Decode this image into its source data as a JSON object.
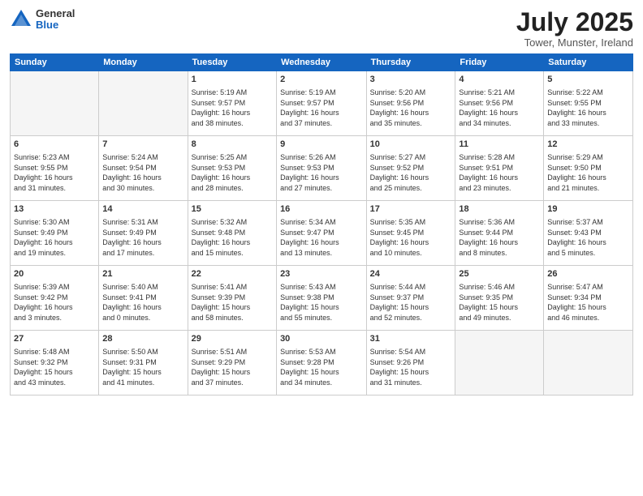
{
  "header": {
    "logo_general": "General",
    "logo_blue": "Blue",
    "month_title": "July 2025",
    "location": "Tower, Munster, Ireland"
  },
  "weekdays": [
    "Sunday",
    "Monday",
    "Tuesday",
    "Wednesday",
    "Thursday",
    "Friday",
    "Saturday"
  ],
  "weeks": [
    [
      {
        "day": "",
        "empty": true
      },
      {
        "day": "",
        "empty": true
      },
      {
        "day": "1",
        "info": "Sunrise: 5:19 AM\nSunset: 9:57 PM\nDaylight: 16 hours\nand 38 minutes."
      },
      {
        "day": "2",
        "info": "Sunrise: 5:19 AM\nSunset: 9:57 PM\nDaylight: 16 hours\nand 37 minutes."
      },
      {
        "day": "3",
        "info": "Sunrise: 5:20 AM\nSunset: 9:56 PM\nDaylight: 16 hours\nand 35 minutes."
      },
      {
        "day": "4",
        "info": "Sunrise: 5:21 AM\nSunset: 9:56 PM\nDaylight: 16 hours\nand 34 minutes."
      },
      {
        "day": "5",
        "info": "Sunrise: 5:22 AM\nSunset: 9:55 PM\nDaylight: 16 hours\nand 33 minutes."
      }
    ],
    [
      {
        "day": "6",
        "info": "Sunrise: 5:23 AM\nSunset: 9:55 PM\nDaylight: 16 hours\nand 31 minutes."
      },
      {
        "day": "7",
        "info": "Sunrise: 5:24 AM\nSunset: 9:54 PM\nDaylight: 16 hours\nand 30 minutes."
      },
      {
        "day": "8",
        "info": "Sunrise: 5:25 AM\nSunset: 9:53 PM\nDaylight: 16 hours\nand 28 minutes."
      },
      {
        "day": "9",
        "info": "Sunrise: 5:26 AM\nSunset: 9:53 PM\nDaylight: 16 hours\nand 27 minutes."
      },
      {
        "day": "10",
        "info": "Sunrise: 5:27 AM\nSunset: 9:52 PM\nDaylight: 16 hours\nand 25 minutes."
      },
      {
        "day": "11",
        "info": "Sunrise: 5:28 AM\nSunset: 9:51 PM\nDaylight: 16 hours\nand 23 minutes."
      },
      {
        "day": "12",
        "info": "Sunrise: 5:29 AM\nSunset: 9:50 PM\nDaylight: 16 hours\nand 21 minutes."
      }
    ],
    [
      {
        "day": "13",
        "info": "Sunrise: 5:30 AM\nSunset: 9:49 PM\nDaylight: 16 hours\nand 19 minutes."
      },
      {
        "day": "14",
        "info": "Sunrise: 5:31 AM\nSunset: 9:49 PM\nDaylight: 16 hours\nand 17 minutes."
      },
      {
        "day": "15",
        "info": "Sunrise: 5:32 AM\nSunset: 9:48 PM\nDaylight: 16 hours\nand 15 minutes."
      },
      {
        "day": "16",
        "info": "Sunrise: 5:34 AM\nSunset: 9:47 PM\nDaylight: 16 hours\nand 13 minutes."
      },
      {
        "day": "17",
        "info": "Sunrise: 5:35 AM\nSunset: 9:45 PM\nDaylight: 16 hours\nand 10 minutes."
      },
      {
        "day": "18",
        "info": "Sunrise: 5:36 AM\nSunset: 9:44 PM\nDaylight: 16 hours\nand 8 minutes."
      },
      {
        "day": "19",
        "info": "Sunrise: 5:37 AM\nSunset: 9:43 PM\nDaylight: 16 hours\nand 5 minutes."
      }
    ],
    [
      {
        "day": "20",
        "info": "Sunrise: 5:39 AM\nSunset: 9:42 PM\nDaylight: 16 hours\nand 3 minutes."
      },
      {
        "day": "21",
        "info": "Sunrise: 5:40 AM\nSunset: 9:41 PM\nDaylight: 16 hours\nand 0 minutes."
      },
      {
        "day": "22",
        "info": "Sunrise: 5:41 AM\nSunset: 9:39 PM\nDaylight: 15 hours\nand 58 minutes."
      },
      {
        "day": "23",
        "info": "Sunrise: 5:43 AM\nSunset: 9:38 PM\nDaylight: 15 hours\nand 55 minutes."
      },
      {
        "day": "24",
        "info": "Sunrise: 5:44 AM\nSunset: 9:37 PM\nDaylight: 15 hours\nand 52 minutes."
      },
      {
        "day": "25",
        "info": "Sunrise: 5:46 AM\nSunset: 9:35 PM\nDaylight: 15 hours\nand 49 minutes."
      },
      {
        "day": "26",
        "info": "Sunrise: 5:47 AM\nSunset: 9:34 PM\nDaylight: 15 hours\nand 46 minutes."
      }
    ],
    [
      {
        "day": "27",
        "info": "Sunrise: 5:48 AM\nSunset: 9:32 PM\nDaylight: 15 hours\nand 43 minutes."
      },
      {
        "day": "28",
        "info": "Sunrise: 5:50 AM\nSunset: 9:31 PM\nDaylight: 15 hours\nand 41 minutes."
      },
      {
        "day": "29",
        "info": "Sunrise: 5:51 AM\nSunset: 9:29 PM\nDaylight: 15 hours\nand 37 minutes."
      },
      {
        "day": "30",
        "info": "Sunrise: 5:53 AM\nSunset: 9:28 PM\nDaylight: 15 hours\nand 34 minutes."
      },
      {
        "day": "31",
        "info": "Sunrise: 5:54 AM\nSunset: 9:26 PM\nDaylight: 15 hours\nand 31 minutes."
      },
      {
        "day": "",
        "empty": true
      },
      {
        "day": "",
        "empty": true
      }
    ]
  ]
}
